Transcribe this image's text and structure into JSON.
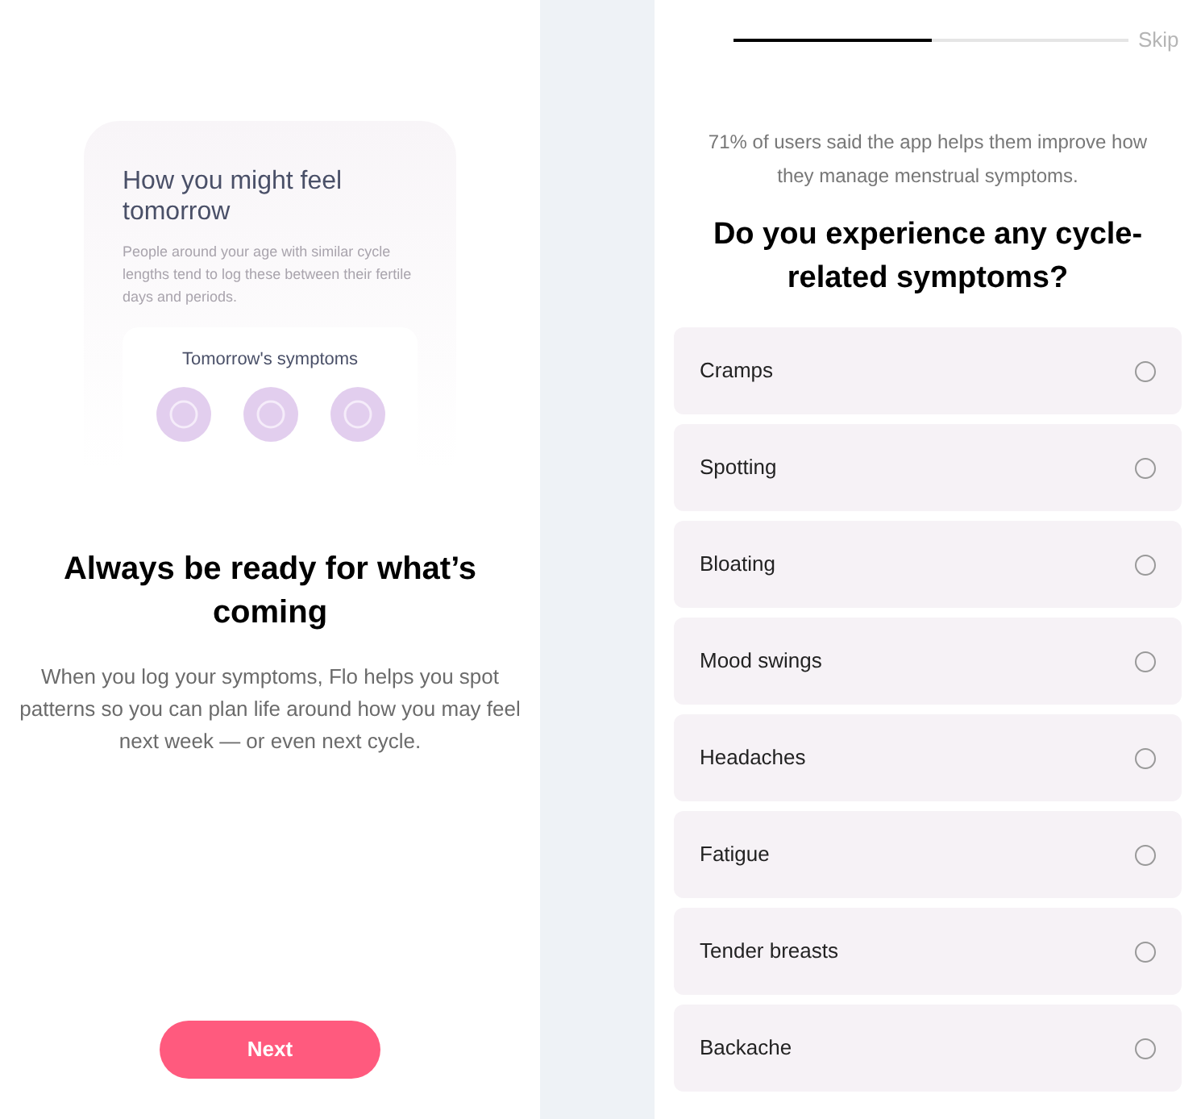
{
  "intro": {
    "card": {
      "title": "How you might feel tomorrow",
      "text": "People around your age with similar cycle lengths tend to log these between their fertile days and periods.",
      "symptoms_title": "Tomorrow's symptoms"
    },
    "heading": "Always be ready for what’s coming",
    "text": "When you log your symptoms, Flo helps you spot patterns so you can plan life around how you may feel next week — or even next cycle.",
    "button": "Next"
  },
  "question": {
    "progress": {
      "level": 0.5
    },
    "skip": "Skip",
    "stat": "71% of users said the app helps them improve how they manage menstrual symptoms.",
    "title": "Do you experience any cycle-related symptoms?",
    "options": [
      {
        "label": "Cramps",
        "selected": false
      },
      {
        "label": "Spotting",
        "selected": false
      },
      {
        "label": "Bloating",
        "selected": false
      },
      {
        "label": "Mood swings",
        "selected": false
      },
      {
        "label": "Headaches",
        "selected": false
      },
      {
        "label": "Fatigue",
        "selected": false
      },
      {
        "label": "Tender breasts",
        "selected": false
      },
      {
        "label": "Backache",
        "selected": false
      }
    ]
  }
}
